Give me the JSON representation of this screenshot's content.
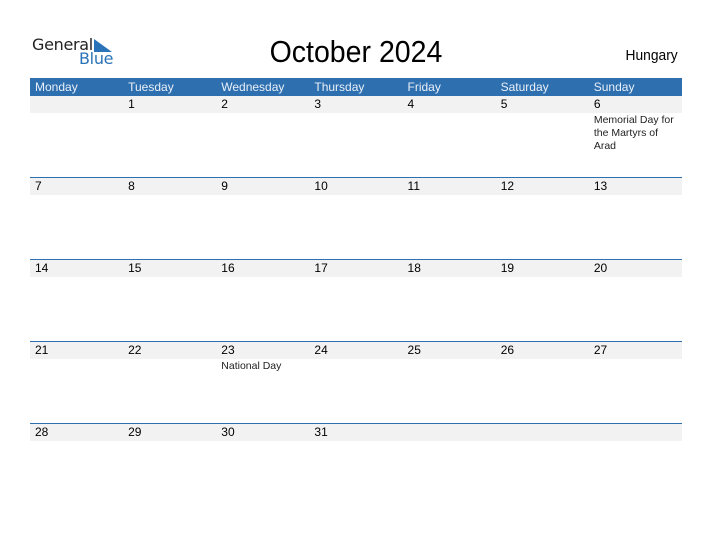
{
  "logo": {
    "line1": "General",
    "line2": "Blue",
    "accent": "#2a73b8"
  },
  "header": {
    "title": "October 2024",
    "country": "Hungary"
  },
  "colors": {
    "header_bg": "#2e6fb0",
    "strip_bg": "#f2f2f2"
  },
  "weekdays": [
    "Monday",
    "Tuesday",
    "Wednesday",
    "Thursday",
    "Friday",
    "Saturday",
    "Sunday"
  ],
  "weeks": [
    {
      "days": [
        {
          "d": "",
          "ev": ""
        },
        {
          "d": "1",
          "ev": ""
        },
        {
          "d": "2",
          "ev": ""
        },
        {
          "d": "3",
          "ev": ""
        },
        {
          "d": "4",
          "ev": ""
        },
        {
          "d": "5",
          "ev": ""
        },
        {
          "d": "6",
          "ev": "Memorial Day for the Martyrs of Arad"
        }
      ]
    },
    {
      "days": [
        {
          "d": "7",
          "ev": ""
        },
        {
          "d": "8",
          "ev": ""
        },
        {
          "d": "9",
          "ev": ""
        },
        {
          "d": "10",
          "ev": ""
        },
        {
          "d": "11",
          "ev": ""
        },
        {
          "d": "12",
          "ev": ""
        },
        {
          "d": "13",
          "ev": ""
        }
      ]
    },
    {
      "days": [
        {
          "d": "14",
          "ev": ""
        },
        {
          "d": "15",
          "ev": ""
        },
        {
          "d": "16",
          "ev": ""
        },
        {
          "d": "17",
          "ev": ""
        },
        {
          "d": "18",
          "ev": ""
        },
        {
          "d": "19",
          "ev": ""
        },
        {
          "d": "20",
          "ev": ""
        }
      ]
    },
    {
      "days": [
        {
          "d": "21",
          "ev": ""
        },
        {
          "d": "22",
          "ev": ""
        },
        {
          "d": "23",
          "ev": "National Day"
        },
        {
          "d": "24",
          "ev": ""
        },
        {
          "d": "25",
          "ev": ""
        },
        {
          "d": "26",
          "ev": ""
        },
        {
          "d": "27",
          "ev": ""
        }
      ]
    },
    {
      "days": [
        {
          "d": "28",
          "ev": ""
        },
        {
          "d": "29",
          "ev": ""
        },
        {
          "d": "30",
          "ev": ""
        },
        {
          "d": "31",
          "ev": ""
        },
        {
          "d": "",
          "ev": ""
        },
        {
          "d": "",
          "ev": ""
        },
        {
          "d": "",
          "ev": ""
        }
      ]
    }
  ]
}
